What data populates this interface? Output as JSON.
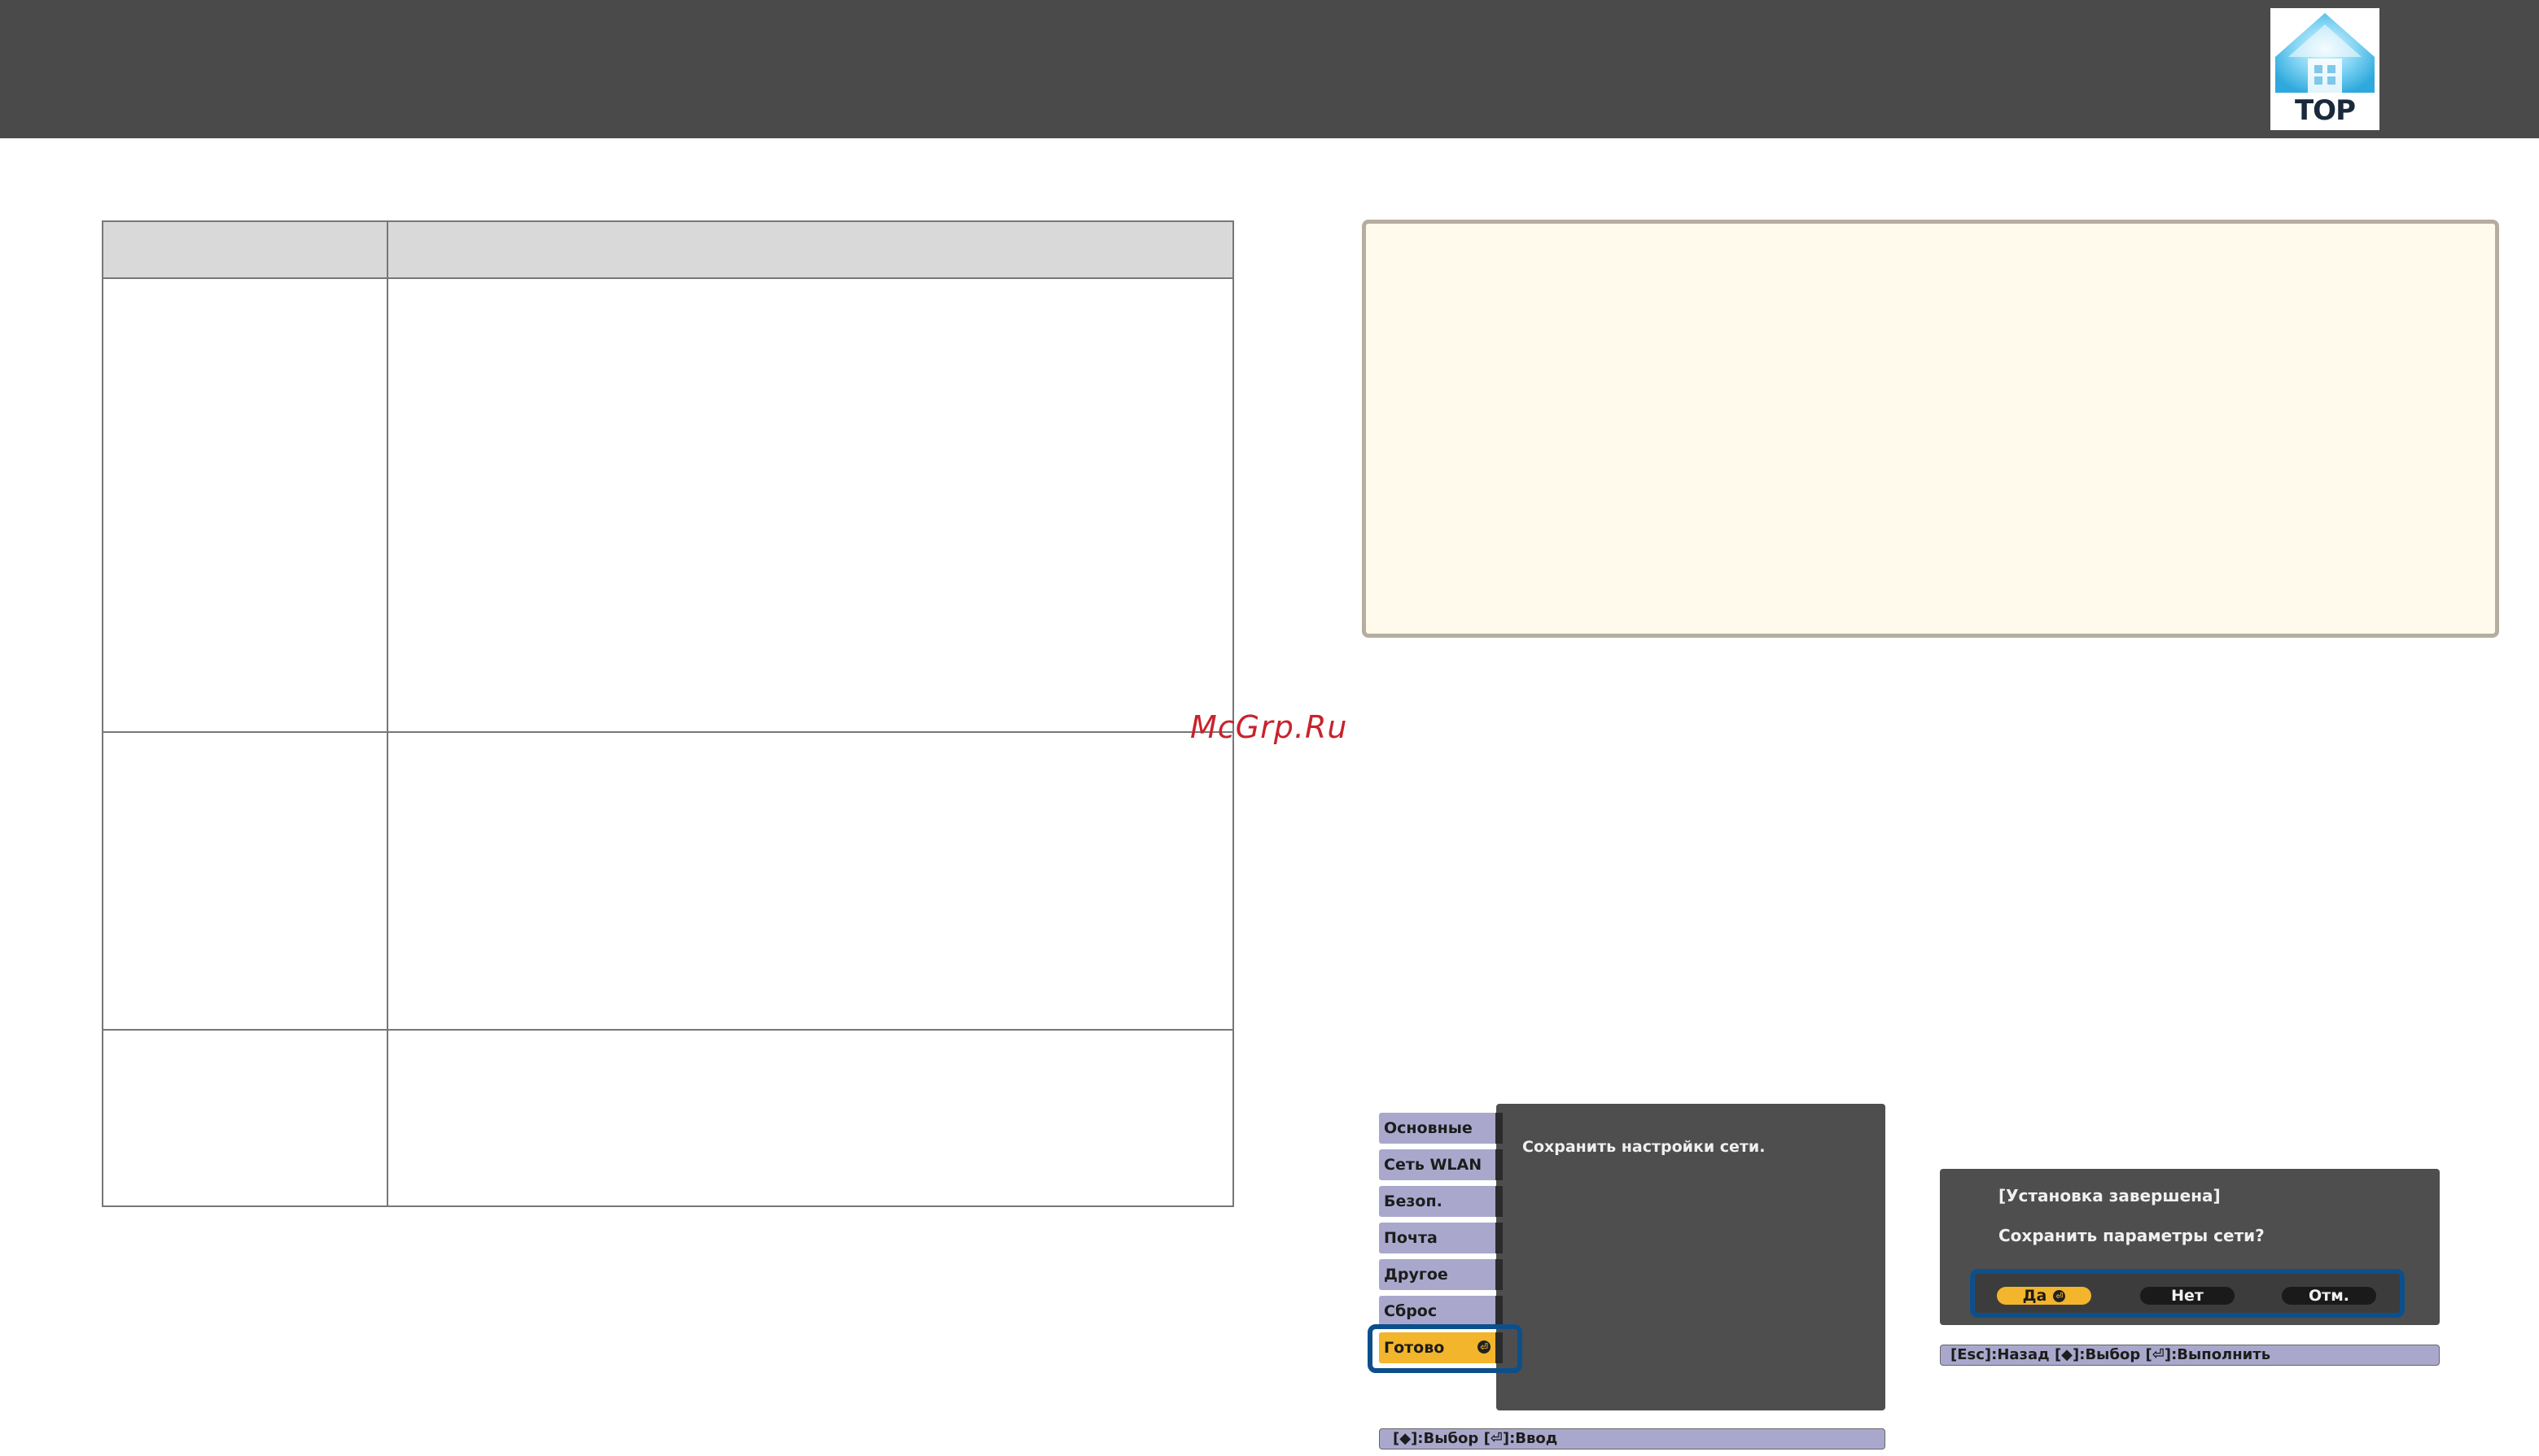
{
  "header": {
    "logo_text": "TOP"
  },
  "watermark": "McGrp.Ru",
  "menu_screen": {
    "tabs": [
      {
        "label": "Основные"
      },
      {
        "label": "Сеть WLAN"
      },
      {
        "label": "Безоп."
      },
      {
        "label": "Почта"
      },
      {
        "label": "Другое"
      },
      {
        "label": "Сброс"
      },
      {
        "label": "Готово"
      }
    ],
    "message": "Сохранить настройки сети.",
    "help": "[◆]:Выбор [⏎]:Ввод"
  },
  "dialog_screen": {
    "title": "[Установка завершена]",
    "question": "Сохранить параметры сети?",
    "buttons": {
      "yes": "Да",
      "no": "Нет",
      "cancel": "Отм."
    },
    "help": "[Esc]:Назад [◆]:Выбор [⏎]:Выполнить"
  },
  "icons": {
    "logo": "home-icon",
    "enter": "enter-icon"
  },
  "colors": {
    "header_bg": "#4a4a4a",
    "note_bg": "#fffaeb",
    "menu_tab": "#a9a8cc",
    "active": "#f2b52c",
    "focus": "#0d4f8b"
  }
}
